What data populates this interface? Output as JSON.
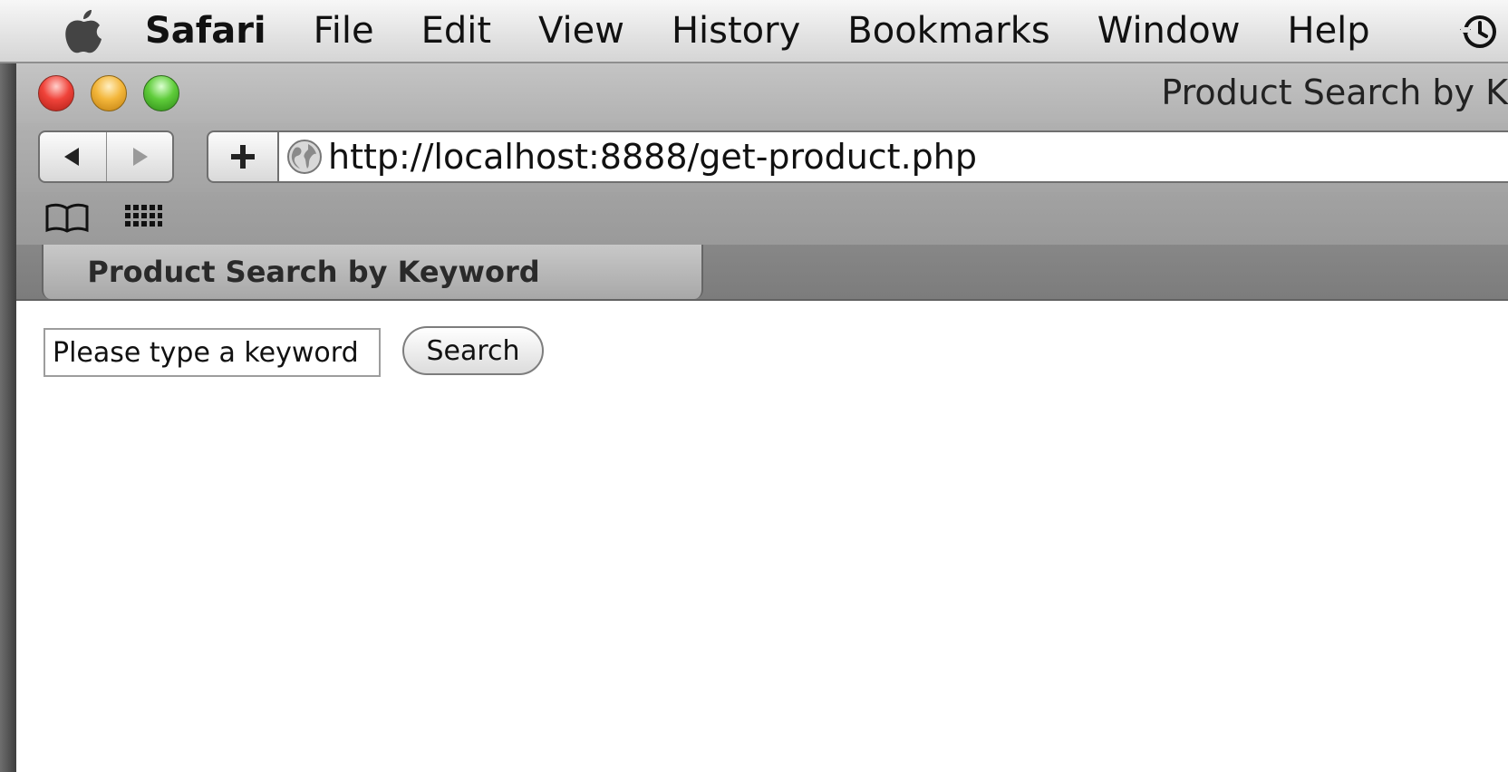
{
  "menubar": {
    "apple_icon": "apple-logo-icon",
    "items": [
      {
        "label": "Safari"
      },
      {
        "label": "File"
      },
      {
        "label": "Edit"
      },
      {
        "label": "View"
      },
      {
        "label": "History"
      },
      {
        "label": "Bookmarks"
      },
      {
        "label": "Window"
      },
      {
        "label": "Help"
      }
    ],
    "time_machine_icon": "clock-history-icon"
  },
  "window": {
    "title": "Product Search by K",
    "controls": [
      "close",
      "minimize",
      "zoom"
    ]
  },
  "toolbar": {
    "back_icon": "back-arrow-icon",
    "forward_icon": "forward-arrow-icon",
    "add_bookmark_icon": "plus-icon",
    "url_icon": "globe-icon",
    "url": "http://localhost:8888/get-product.php"
  },
  "bookmarks_bar": {
    "icons": [
      "open-book-icon",
      "grid-icon"
    ]
  },
  "tab": {
    "label": "Product Search by Keyword"
  },
  "page": {
    "keyword_input": {
      "value": "Please type a keyword"
    },
    "search_button": {
      "label": "Search"
    }
  },
  "colors": {
    "close": "#f0433a",
    "minimize": "#f3b63a",
    "zoom": "#5fcc3a"
  }
}
